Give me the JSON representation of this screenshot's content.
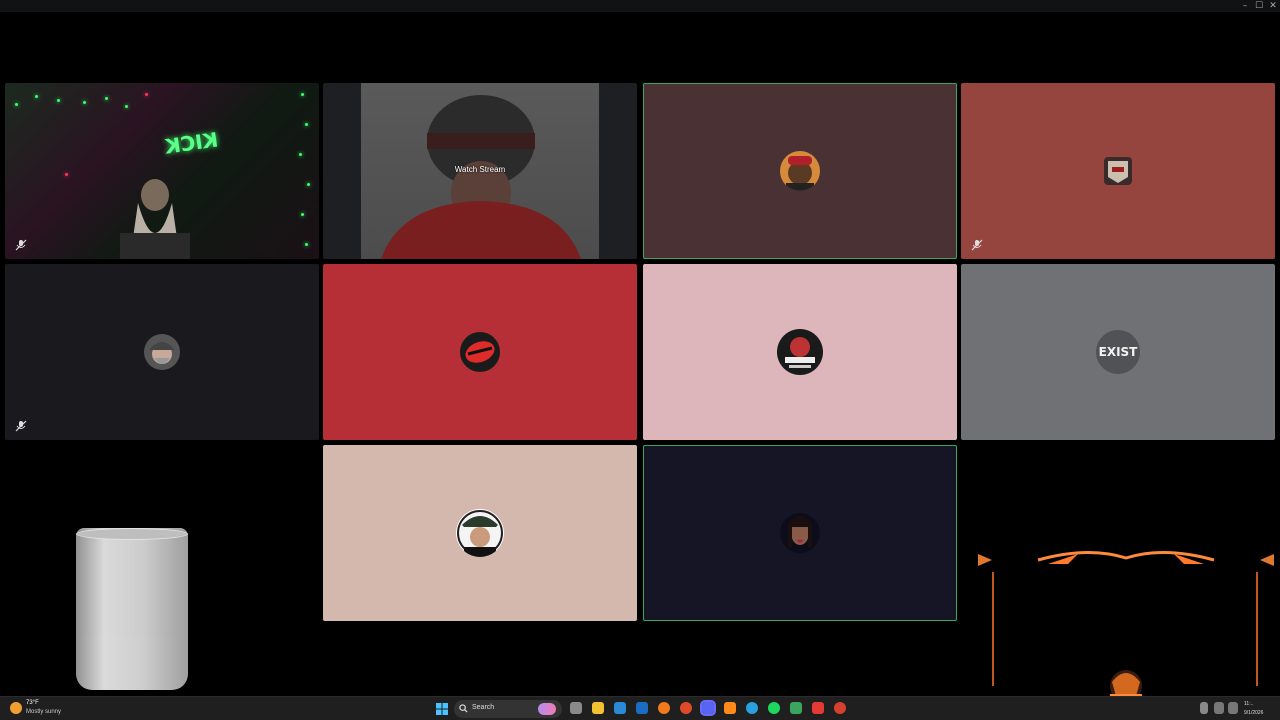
{
  "window": {
    "controls": [
      "–",
      "☐",
      "✕"
    ]
  },
  "stream": {
    "watch_label": "Watch Stream"
  },
  "tiles": {
    "webcam": {
      "neon_sign": "KICK"
    },
    "exist": {
      "avatar_text": "EXIST"
    }
  },
  "taskbar": {
    "weather": {
      "temp": "73°F",
      "desc": "Mostly sunny"
    },
    "search_placeholder": "Search",
    "tray": {
      "time": "11:..",
      "date": "9/1/2026"
    }
  }
}
